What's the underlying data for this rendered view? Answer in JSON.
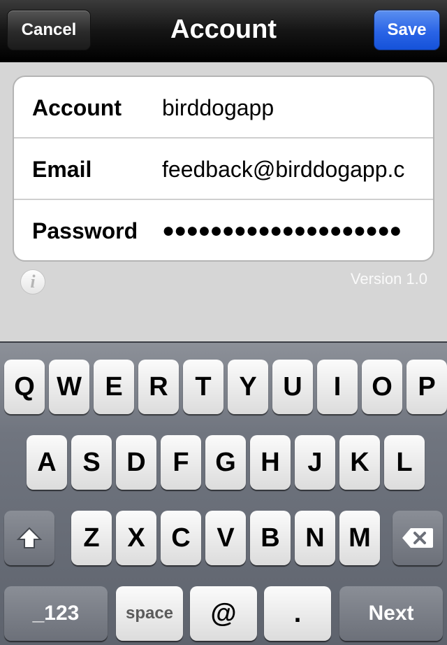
{
  "navbar": {
    "title": "Account",
    "cancel_label": "Cancel",
    "save_label": "Save"
  },
  "form": {
    "rows": [
      {
        "label": "Account",
        "value": "birddogapp"
      },
      {
        "label": "Email",
        "value": "feedback@birddogapp.c"
      },
      {
        "label": "Password",
        "value": "●●●●●●●●●●●●●●●●●●●●"
      }
    ]
  },
  "info_icon": "info-icon",
  "version": "Version 1.0",
  "keyboard": {
    "row1": [
      "Q",
      "W",
      "E",
      "R",
      "T",
      "Y",
      "U",
      "I",
      "O",
      "P"
    ],
    "row2": [
      "A",
      "S",
      "D",
      "F",
      "G",
      "H",
      "J",
      "K",
      "L"
    ],
    "row3": [
      "Z",
      "X",
      "C",
      "V",
      "B",
      "N",
      "M"
    ],
    "shift_icon": "shift-icon",
    "delete_icon": "delete-icon",
    "numbers_label": "_123",
    "space_label": "space",
    "at_label": "@",
    "dot_label": ".",
    "next_label": "Next"
  },
  "colors": {
    "save_button": "#2a64e6",
    "navbar": "#151515",
    "background": "#d6d6d6"
  }
}
